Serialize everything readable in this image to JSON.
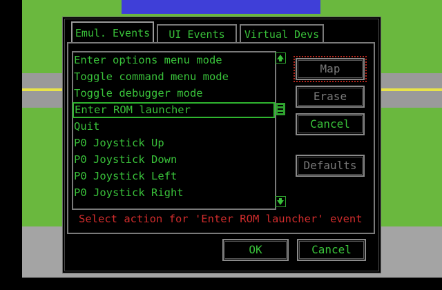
{
  "tabs": [
    "Emul. Events",
    "UI Events",
    "Virtual Devs"
  ],
  "events": [
    "Enter options menu mode",
    "Toggle command menu mode",
    "Toggle debugger mode",
    "Enter ROM launcher",
    "Quit",
    "P0 Joystick Up",
    "P0 Joystick Down",
    "P0 Joystick Left",
    "P0 Joystick Right"
  ],
  "selected_event": 3,
  "side_buttons": {
    "map": "Map",
    "erase": "Erase",
    "cancel": "Cancel",
    "defaults": "Defaults"
  },
  "status": "Select action for 'Enter ROM launcher' event",
  "footer": {
    "ok": "OK",
    "cancel": "Cancel"
  },
  "scrollbar_position": 0.33,
  "colors": {
    "text_green": "#39c23a",
    "status_red": "#d02c2c",
    "disabled_gray": "#7a7a7a",
    "background": "#000000"
  },
  "icons": {
    "scroll_up": "arrow-up-icon",
    "scroll_down": "arrow-down-icon"
  }
}
